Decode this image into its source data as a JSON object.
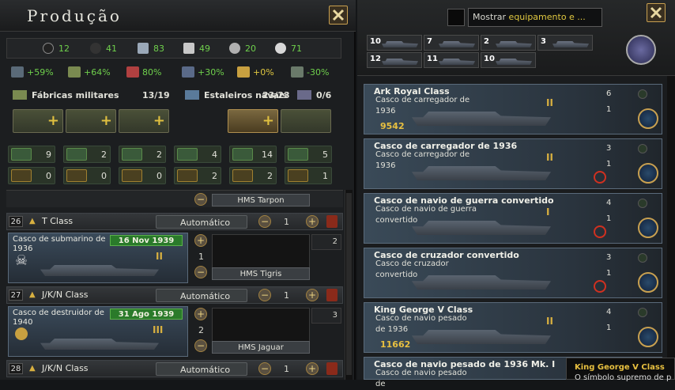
{
  "left": {
    "title": "Produção",
    "resources": [
      {
        "icon": "oil-icon",
        "value": "12"
      },
      {
        "icon": "rubber-icon",
        "value": "41"
      },
      {
        "icon": "steel-icon",
        "value": "83"
      },
      {
        "icon": "aluminium-icon",
        "value": "49"
      },
      {
        "icon": "tungsten-icon",
        "value": "20"
      },
      {
        "icon": "chromium-icon",
        "value": "71"
      }
    ],
    "bonuses": [
      {
        "icon": "factory-bonus-icon",
        "value": "+59%",
        "color": "green"
      },
      {
        "icon": "supply-bonus-icon",
        "value": "+64%",
        "color": "green"
      },
      {
        "icon": "efficiency-icon",
        "value": "80%",
        "color": "green"
      },
      {
        "icon": "output-icon",
        "value": "+30%",
        "color": "green"
      },
      {
        "icon": "growth-icon",
        "value": "+0%",
        "color": "yellow"
      },
      {
        "icon": "resource-icon",
        "value": "-30%",
        "color": "green"
      }
    ],
    "military_factories_label": "Fábricas militares",
    "military_factories_value": "13/19",
    "naval_dockyards_label": "Estaleiros navais",
    "naval_dockyards_value": "23/23",
    "civilian_value": "0/6",
    "slots_row1": [
      "9",
      "2",
      "2",
      "4",
      "14",
      "5"
    ],
    "slots_row2": [
      "0",
      "0",
      "0",
      "2",
      "2",
      "1"
    ],
    "top_hms": "HMS Tarpon",
    "auto_label": "Automático",
    "queue": [
      {
        "num": "26",
        "name": "T Class",
        "qty": "1",
        "card_name": "Casco de submarino de 1936",
        "date": "16 Nov 1939",
        "rank": "II",
        "factories": "1",
        "hms": "HMS Tigris",
        "side": "2"
      },
      {
        "num": "27",
        "name": "J/K/N Class",
        "qty": "1",
        "card_name": "Casco de destruidor de 1940",
        "date": "31 Ago 1939",
        "rank": "III",
        "factories": "2",
        "hms": "HMS Jaguar",
        "side": "3"
      },
      {
        "num": "28",
        "name": "J/K/N Class",
        "qty": "1"
      }
    ]
  },
  "right": {
    "filter_label_white": "Mostrar ",
    "filter_label_yellow": "equipamento e ...",
    "tabs": [
      {
        "num": "10"
      },
      {
        "num": "7"
      },
      {
        "num": "2"
      },
      {
        "num": "3"
      },
      {
        "num": "12"
      },
      {
        "num": "11"
      },
      {
        "num": "10"
      }
    ],
    "cards": [
      {
        "name": "Ark Royal Class",
        "sub": "Casco de carregador de 1936",
        "rank": "II",
        "cost": "9542",
        "stat1": "6",
        "stat2": "1"
      },
      {
        "name": "Casco de carregador de 1936",
        "sub": "Casco de carregador de 1936",
        "rank": "II",
        "cost": "",
        "stat1": "3",
        "stat2": "1"
      },
      {
        "name": "Casco de navio de guerra convertido",
        "sub": "Casco de navio de guerra convertido",
        "rank": "I",
        "cost": "",
        "stat1": "4",
        "stat2": "1"
      },
      {
        "name": "Casco de cruzador convertido",
        "sub": "Casco de cruzador convertido",
        "rank": "",
        "cost": "",
        "stat1": "3",
        "stat2": "1"
      },
      {
        "name": "King George V Class",
        "sub": "Casco de navio pesado de 1936",
        "rank": "II",
        "cost": "11662",
        "stat1": "4",
        "stat2": "1"
      },
      {
        "name": "Casco de navio pesado de 1936 Mk. I",
        "sub": "Casco de navio pesado de",
        "rank": "",
        "cost": ""
      }
    ],
    "tooltip_title": "King George V Class",
    "tooltip_text": "O símbolo supremo de p"
  }
}
